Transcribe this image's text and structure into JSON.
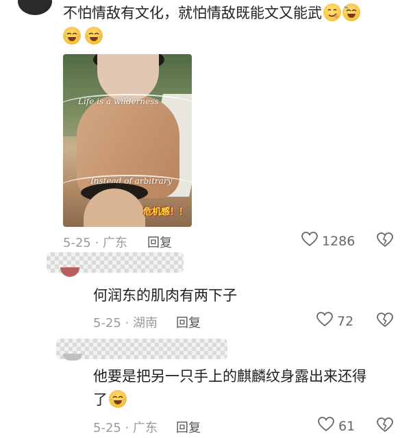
{
  "comments": [
    {
      "text": "不怕情敌有文化，就怕情敌既能文又能武",
      "image": {
        "script_top": "Life is a wilderness",
        "script_bottom": "Instead of arbitrary",
        "caption": "危机感！！"
      },
      "date_location": "5-25 · 广东",
      "reply_label": "回复",
      "likes": "1286"
    },
    {
      "text": "何润东的肌肉有两下子",
      "date_location": "5-25 · 湖南",
      "reply_label": "回复",
      "likes": "72"
    },
    {
      "text_line1": "他要是把另一只手上的麒麟纹身露出来还得",
      "text_line2": "了",
      "date_location": "5-25 · 广东",
      "reply_label": "回复",
      "likes": "61"
    }
  ],
  "icons": {
    "like": "heart-outline-icon",
    "dislike": "heart-broken-outline-icon",
    "emoji1": "smirk-emoji-icon",
    "emoji2": "grin-emoji-icon",
    "emoji3": "tears-of-joy-emoji-icon",
    "emoji4": "tears-of-joy-emoji-icon",
    "emoji5": "tears-of-joy-emoji-icon"
  },
  "colors": {
    "text": "#1f1f1f",
    "meta": "#9a9a9a",
    "icon": "#666666",
    "caption": "#ffe23a"
  }
}
